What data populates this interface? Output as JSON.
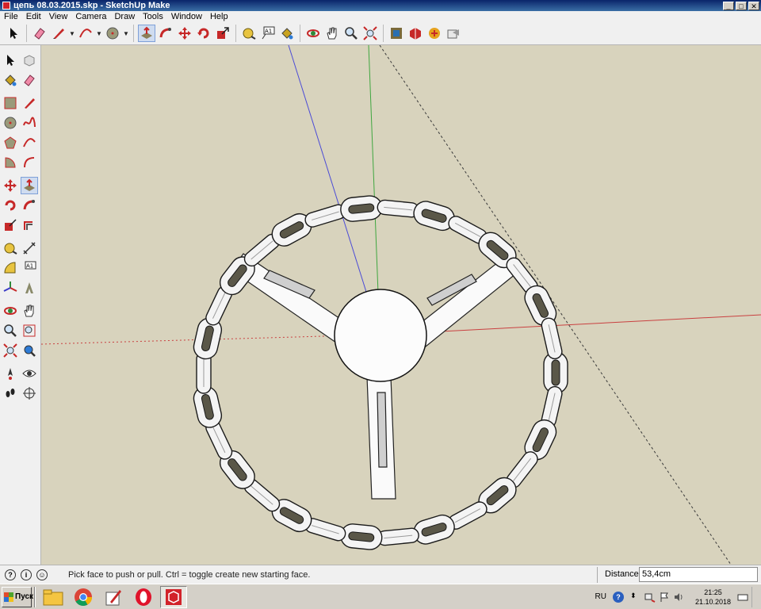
{
  "window": {
    "title": "цепь 08.03.2015.skp - SketchUp Make",
    "buttons": [
      "_",
      "□",
      "✕"
    ]
  },
  "menubar": [
    "File",
    "Edit",
    "View",
    "Camera",
    "Draw",
    "Tools",
    "Window",
    "Help"
  ],
  "toolbar": {
    "tools": [
      {
        "name": "select-tool",
        "icon": "arrow-icon"
      },
      {
        "name": "eraser-tool",
        "icon": "eraser-icon"
      },
      {
        "name": "pencil-tool",
        "icon": "pencil-icon"
      },
      {
        "name": "arc-tool",
        "icon": "arc-icon"
      },
      {
        "name": "circle-tool",
        "icon": "circle-icon"
      },
      {
        "name": "push-pull-tool",
        "icon": "push-pull-icon",
        "active": true
      },
      {
        "name": "follow-me-tool",
        "icon": "follow-me-icon"
      },
      {
        "name": "move-tool",
        "icon": "move-icon"
      },
      {
        "name": "rotate-tool",
        "icon": "rotate-icon"
      },
      {
        "name": "scale-tool",
        "icon": "scale-icon"
      },
      {
        "name": "tape-measure-tool",
        "icon": "tape-icon"
      },
      {
        "name": "text-tool",
        "icon": "text-icon"
      },
      {
        "name": "paint-bucket-tool",
        "icon": "paint-bucket-icon"
      },
      {
        "name": "orbit-tool",
        "icon": "orbit-icon"
      },
      {
        "name": "pan-tool",
        "icon": "hand-icon"
      },
      {
        "name": "zoom-tool",
        "icon": "magnifier-icon"
      },
      {
        "name": "zoom-extents-tool",
        "icon": "zoom-extents-icon"
      },
      {
        "name": "warehouse-button",
        "icon": "warehouse-icon"
      },
      {
        "name": "extension-warehouse-button",
        "icon": "extension-icon"
      },
      {
        "name": "share-model-button",
        "icon": "share-icon"
      },
      {
        "name": "send-to-layout-button",
        "icon": "layout-icon"
      }
    ],
    "text_tool_glyph": "A1"
  },
  "status": {
    "hint": "Pick face to push or pull.  Ctrl = toggle create new starting face.",
    "distance_label": "Distance",
    "distance_value": "53,4cm",
    "icons": [
      "?",
      "i",
      "☺"
    ]
  },
  "taskbar": {
    "start_label": "Пуск",
    "language": "RU",
    "time": "21:25",
    "date": "21.10.2018",
    "apps": [
      "explorer-icon",
      "chrome-icon",
      "editor-icon",
      "opera-icon",
      "sketchup-icon"
    ]
  },
  "scene": {
    "background": "#d8d3bd",
    "axis_colors": {
      "red": "#c94040",
      "green": "#3fa63f",
      "blue": "#4b4bd6"
    },
    "wheel": {
      "chain_links": 30,
      "spokes": 3
    }
  }
}
